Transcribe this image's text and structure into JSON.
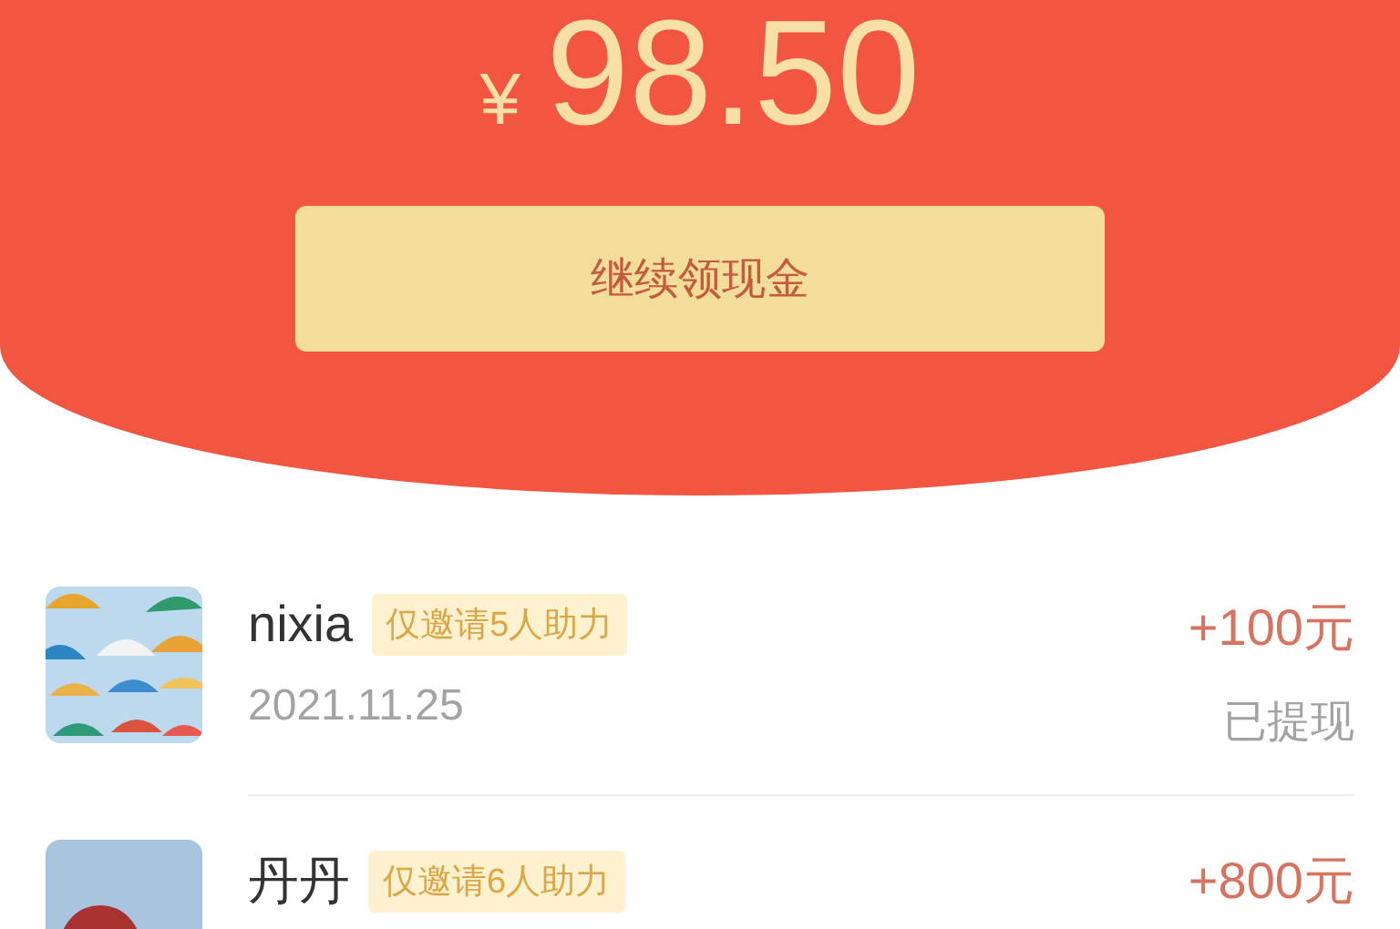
{
  "balance": {
    "currency": "¥",
    "amount": "98.50"
  },
  "action_button": {
    "label": "继续领现金"
  },
  "records": [
    {
      "name": "nixia",
      "tag": "仅邀请5人助力",
      "date": "2021.11.25",
      "amount": "+100元",
      "status": "已提现"
    },
    {
      "name": "丹丹",
      "tag": "仅邀请6人助力",
      "amount": "+800元"
    }
  ]
}
